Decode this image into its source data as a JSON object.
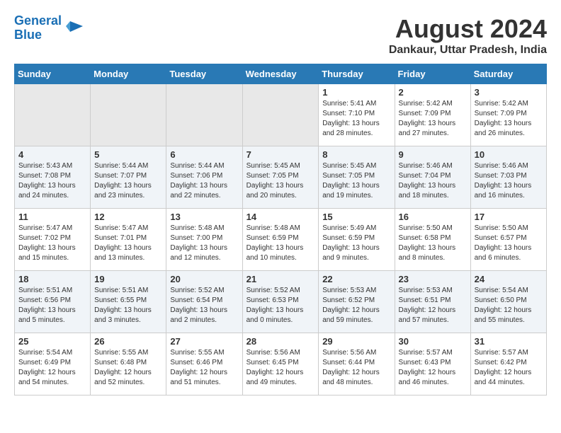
{
  "header": {
    "logo_line1": "General",
    "logo_line2": "Blue",
    "title": "August 2024",
    "subtitle": "Dankaur, Uttar Pradesh, India"
  },
  "weekdays": [
    "Sunday",
    "Monday",
    "Tuesday",
    "Wednesday",
    "Thursday",
    "Friday",
    "Saturday"
  ],
  "weeks": [
    [
      {
        "day": "",
        "detail": ""
      },
      {
        "day": "",
        "detail": ""
      },
      {
        "day": "",
        "detail": ""
      },
      {
        "day": "",
        "detail": ""
      },
      {
        "day": "1",
        "detail": "Sunrise: 5:41 AM\nSunset: 7:10 PM\nDaylight: 13 hours\nand 28 minutes."
      },
      {
        "day": "2",
        "detail": "Sunrise: 5:42 AM\nSunset: 7:09 PM\nDaylight: 13 hours\nand 27 minutes."
      },
      {
        "day": "3",
        "detail": "Sunrise: 5:42 AM\nSunset: 7:09 PM\nDaylight: 13 hours\nand 26 minutes."
      }
    ],
    [
      {
        "day": "4",
        "detail": "Sunrise: 5:43 AM\nSunset: 7:08 PM\nDaylight: 13 hours\nand 24 minutes."
      },
      {
        "day": "5",
        "detail": "Sunrise: 5:44 AM\nSunset: 7:07 PM\nDaylight: 13 hours\nand 23 minutes."
      },
      {
        "day": "6",
        "detail": "Sunrise: 5:44 AM\nSunset: 7:06 PM\nDaylight: 13 hours\nand 22 minutes."
      },
      {
        "day": "7",
        "detail": "Sunrise: 5:45 AM\nSunset: 7:05 PM\nDaylight: 13 hours\nand 20 minutes."
      },
      {
        "day": "8",
        "detail": "Sunrise: 5:45 AM\nSunset: 7:05 PM\nDaylight: 13 hours\nand 19 minutes."
      },
      {
        "day": "9",
        "detail": "Sunrise: 5:46 AM\nSunset: 7:04 PM\nDaylight: 13 hours\nand 18 minutes."
      },
      {
        "day": "10",
        "detail": "Sunrise: 5:46 AM\nSunset: 7:03 PM\nDaylight: 13 hours\nand 16 minutes."
      }
    ],
    [
      {
        "day": "11",
        "detail": "Sunrise: 5:47 AM\nSunset: 7:02 PM\nDaylight: 13 hours\nand 15 minutes."
      },
      {
        "day": "12",
        "detail": "Sunrise: 5:47 AM\nSunset: 7:01 PM\nDaylight: 13 hours\nand 13 minutes."
      },
      {
        "day": "13",
        "detail": "Sunrise: 5:48 AM\nSunset: 7:00 PM\nDaylight: 13 hours\nand 12 minutes."
      },
      {
        "day": "14",
        "detail": "Sunrise: 5:48 AM\nSunset: 6:59 PM\nDaylight: 13 hours\nand 10 minutes."
      },
      {
        "day": "15",
        "detail": "Sunrise: 5:49 AM\nSunset: 6:59 PM\nDaylight: 13 hours\nand 9 minutes."
      },
      {
        "day": "16",
        "detail": "Sunrise: 5:50 AM\nSunset: 6:58 PM\nDaylight: 13 hours\nand 8 minutes."
      },
      {
        "day": "17",
        "detail": "Sunrise: 5:50 AM\nSunset: 6:57 PM\nDaylight: 13 hours\nand 6 minutes."
      }
    ],
    [
      {
        "day": "18",
        "detail": "Sunrise: 5:51 AM\nSunset: 6:56 PM\nDaylight: 13 hours\nand 5 minutes."
      },
      {
        "day": "19",
        "detail": "Sunrise: 5:51 AM\nSunset: 6:55 PM\nDaylight: 13 hours\nand 3 minutes."
      },
      {
        "day": "20",
        "detail": "Sunrise: 5:52 AM\nSunset: 6:54 PM\nDaylight: 13 hours\nand 2 minutes."
      },
      {
        "day": "21",
        "detail": "Sunrise: 5:52 AM\nSunset: 6:53 PM\nDaylight: 13 hours\nand 0 minutes."
      },
      {
        "day": "22",
        "detail": "Sunrise: 5:53 AM\nSunset: 6:52 PM\nDaylight: 12 hours\nand 59 minutes."
      },
      {
        "day": "23",
        "detail": "Sunrise: 5:53 AM\nSunset: 6:51 PM\nDaylight: 12 hours\nand 57 minutes."
      },
      {
        "day": "24",
        "detail": "Sunrise: 5:54 AM\nSunset: 6:50 PM\nDaylight: 12 hours\nand 55 minutes."
      }
    ],
    [
      {
        "day": "25",
        "detail": "Sunrise: 5:54 AM\nSunset: 6:49 PM\nDaylight: 12 hours\nand 54 minutes."
      },
      {
        "day": "26",
        "detail": "Sunrise: 5:55 AM\nSunset: 6:48 PM\nDaylight: 12 hours\nand 52 minutes."
      },
      {
        "day": "27",
        "detail": "Sunrise: 5:55 AM\nSunset: 6:46 PM\nDaylight: 12 hours\nand 51 minutes."
      },
      {
        "day": "28",
        "detail": "Sunrise: 5:56 AM\nSunset: 6:45 PM\nDaylight: 12 hours\nand 49 minutes."
      },
      {
        "day": "29",
        "detail": "Sunrise: 5:56 AM\nSunset: 6:44 PM\nDaylight: 12 hours\nand 48 minutes."
      },
      {
        "day": "30",
        "detail": "Sunrise: 5:57 AM\nSunset: 6:43 PM\nDaylight: 12 hours\nand 46 minutes."
      },
      {
        "day": "31",
        "detail": "Sunrise: 5:57 AM\nSunset: 6:42 PM\nDaylight: 12 hours\nand 44 minutes."
      }
    ]
  ]
}
